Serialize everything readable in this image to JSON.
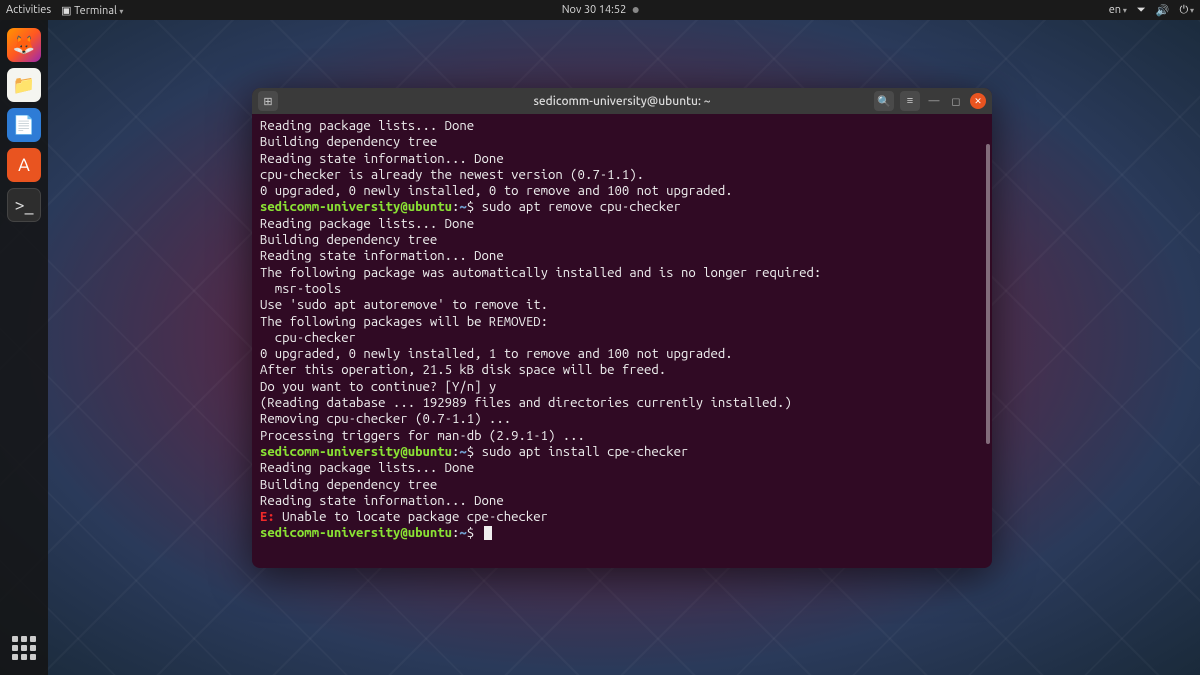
{
  "topbar": {
    "activities": "Activities",
    "app_menu": "Terminal",
    "datetime": "Nov 30  14:52",
    "lang": "en"
  },
  "dock": {
    "firefox": "firefox",
    "files": "files",
    "docs": "document-editor",
    "store": "ubuntu-software",
    "terminal": "terminal",
    "apps": "show-applications"
  },
  "window": {
    "title": "sedicomm-university@ubuntu: ~"
  },
  "prompt": {
    "user_host": "sedicomm-university@ubuntu",
    "separator": ":",
    "path": "~",
    "symbol": "$"
  },
  "terminal": {
    "lines": [
      {
        "t": "out",
        "text": "Reading package lists... Done"
      },
      {
        "t": "out",
        "text": "Building dependency tree"
      },
      {
        "t": "out",
        "text": "Reading state information... Done"
      },
      {
        "t": "out",
        "text": "cpu-checker is already the newest version (0.7-1.1)."
      },
      {
        "t": "out",
        "text": "0 upgraded, 0 newly installed, 0 to remove and 100 not upgraded."
      },
      {
        "t": "cmd",
        "text": " sudo apt remove cpu-checker"
      },
      {
        "t": "out",
        "text": "Reading package lists... Done"
      },
      {
        "t": "out",
        "text": "Building dependency tree"
      },
      {
        "t": "out",
        "text": "Reading state information... Done"
      },
      {
        "t": "out",
        "text": "The following package was automatically installed and is no longer required:"
      },
      {
        "t": "out",
        "text": "  msr-tools"
      },
      {
        "t": "out",
        "text": "Use 'sudo apt autoremove' to remove it."
      },
      {
        "t": "out",
        "text": "The following packages will be REMOVED:"
      },
      {
        "t": "out",
        "text": "  cpu-checker"
      },
      {
        "t": "out",
        "text": "0 upgraded, 0 newly installed, 1 to remove and 100 not upgraded."
      },
      {
        "t": "out",
        "text": "After this operation, 21.5 kB disk space will be freed."
      },
      {
        "t": "out",
        "text": "Do you want to continue? [Y/n] y"
      },
      {
        "t": "out",
        "text": "(Reading database ... 192989 files and directories currently installed.)"
      },
      {
        "t": "out",
        "text": "Removing cpu-checker (0.7-1.1) ..."
      },
      {
        "t": "out",
        "text": "Processing triggers for man-db (2.9.1-1) ..."
      },
      {
        "t": "cmd",
        "text": " sudo apt install cpe-checker"
      },
      {
        "t": "out",
        "text": "Reading package lists... Done"
      },
      {
        "t": "out",
        "text": "Building dependency tree"
      },
      {
        "t": "out",
        "text": "Reading state information... Done"
      },
      {
        "t": "err",
        "prefix": "E:",
        "text": " Unable to locate package cpe-checker"
      },
      {
        "t": "cmd",
        "text": " ",
        "cursor": true
      }
    ]
  }
}
